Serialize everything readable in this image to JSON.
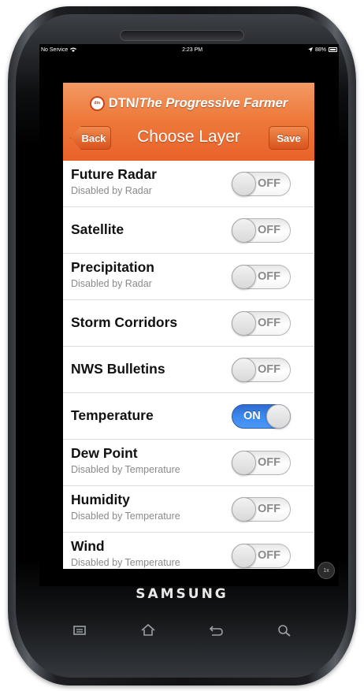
{
  "status_bar": {
    "carrier": "No Service",
    "time": "2:23 PM",
    "battery": "88%"
  },
  "app": {
    "brand_prefix": "DTN/",
    "brand_name": "The Progressive Farmer",
    "logo_text": "dtn",
    "back_label": "Back",
    "title": "Choose Layer",
    "save_label": "Save"
  },
  "layers": [
    {
      "name": "Future Radar",
      "subtitle": "Disabled by Radar",
      "state": "OFF"
    },
    {
      "name": "Satellite",
      "subtitle": "",
      "state": "OFF"
    },
    {
      "name": "Precipitation",
      "subtitle": "Disabled by Radar",
      "state": "OFF"
    },
    {
      "name": "Storm Corridors",
      "subtitle": "",
      "state": "OFF"
    },
    {
      "name": "NWS Bulletins",
      "subtitle": "",
      "state": "OFF"
    },
    {
      "name": "Temperature",
      "subtitle": "",
      "state": "ON"
    },
    {
      "name": "Dew Point",
      "subtitle": "Disabled by Temperature",
      "state": "OFF"
    },
    {
      "name": "Humidity",
      "subtitle": "Disabled by Temperature",
      "state": "OFF"
    },
    {
      "name": "Wind",
      "subtitle": "Disabled by Temperature",
      "state": "OFF"
    }
  ],
  "device": {
    "brand": "SAMSUNG",
    "zoom_badge": "1x"
  },
  "colors": {
    "header_orange": "#ee7a3c",
    "toggle_on_blue": "#3d8bf0"
  },
  "icons": [
    "wifi-icon",
    "location-arrow-icon",
    "battery-icon",
    "menu-key-icon",
    "home-key-icon",
    "back-key-icon",
    "search-key-icon",
    "dtn-logo-icon"
  ]
}
